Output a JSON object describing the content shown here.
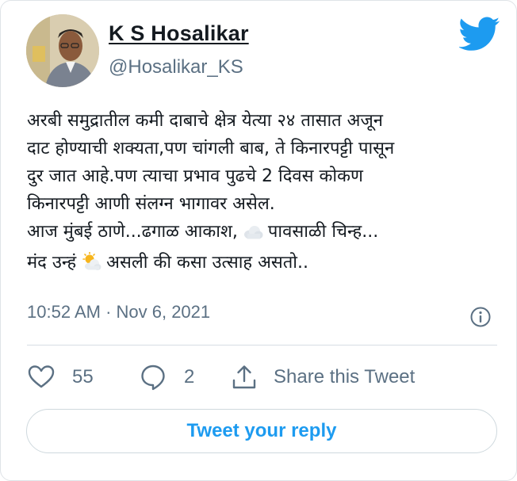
{
  "author": {
    "name": "K S Hosalikar",
    "handle": "@Hosalikar_KS"
  },
  "tweet": {
    "lines": [
      "अरबी समुद्रातील कमी दाबाचे क्षेत्र येत्या २४ तासात अजून",
      "दाट होण्याची शक्यता,पण चांगली बाब, ते किनारपट्टी पासून",
      "दुर जात आहे.पण त्याचा प्रभाव पुढचे 2 दिवस कोकण",
      "किनारपट्टी आणी संलग्न भागावर असेल."
    ],
    "line5_before": "आज मुंबई ठाणे...ढगाळ आकाश,",
    "line5_after": "पावसाळी चिन्ह...",
    "line6_before": "मंद उन्हं",
    "line6_after": "असली की कसा उत्साह असतो..",
    "emojis": [
      "cloud-emoji",
      "sun-behind-cloud-emoji"
    ],
    "timestamp": "10:52 AM · Nov 6, 2021"
  },
  "actions": {
    "likes": "55",
    "replies": "2",
    "share_label": "Share this Tweet",
    "reply_button_label": "Tweet your reply"
  },
  "colors": {
    "brand": "#1d9bf0",
    "secondary_text": "#5b7083",
    "primary_text": "#141a20"
  },
  "icons": [
    "twitter-bird-icon",
    "info-icon",
    "heart-icon",
    "reply-icon",
    "share-icon"
  ]
}
